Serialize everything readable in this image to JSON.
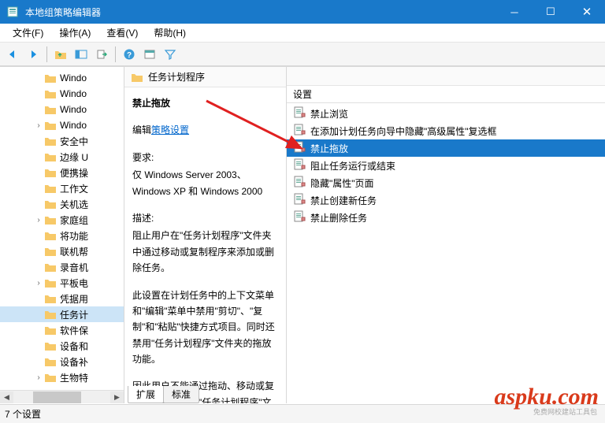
{
  "window": {
    "title": "本地组策略编辑器"
  },
  "menubar": {
    "file": "文件(F)",
    "action": "操作(A)",
    "view": "查看(V)",
    "help": "帮助(H)"
  },
  "tree": {
    "items": [
      {
        "label": "Windo",
        "expand": ""
      },
      {
        "label": "Windo",
        "expand": ""
      },
      {
        "label": "Windo",
        "expand": ""
      },
      {
        "label": "Windo",
        "expand": "›"
      },
      {
        "label": "安全中",
        "expand": ""
      },
      {
        "label": "边缘 U",
        "expand": ""
      },
      {
        "label": "便携操",
        "expand": ""
      },
      {
        "label": "工作文",
        "expand": ""
      },
      {
        "label": "关机选",
        "expand": ""
      },
      {
        "label": "家庭组",
        "expand": "›"
      },
      {
        "label": "将功能",
        "expand": ""
      },
      {
        "label": "联机帮",
        "expand": ""
      },
      {
        "label": "录音机",
        "expand": ""
      },
      {
        "label": "平板电",
        "expand": "›"
      },
      {
        "label": "凭据用",
        "expand": ""
      },
      {
        "label": "任务计",
        "expand": "",
        "selected": true
      },
      {
        "label": "软件保",
        "expand": ""
      },
      {
        "label": "设备和",
        "expand": ""
      },
      {
        "label": "设备补",
        "expand": ""
      },
      {
        "label": "生物特",
        "expand": "›"
      }
    ]
  },
  "mid": {
    "header": "任务计划程序",
    "title": "禁止拖放",
    "edit_link_prefix": "编辑",
    "edit_link": "策略设置",
    "req_label": "要求:",
    "req_text": "仅 Windows Server 2003、Windows XP 和 Windows 2000",
    "desc_label": "描述:",
    "desc1": "阻止用户在\"任务计划程序\"文件夹中通过移动或复制程序来添加或删除任务。",
    "desc2": "此设置在计划任务中的上下文菜单和\"编辑\"菜单中禁用\"剪切\"、\"复制\"和\"粘贴\"快捷方式项目。同时还禁用\"任务计划程序\"文件夹的拖放功能。",
    "desc3": "因此用户不能通过拖动、移动或复制文档或程序向\"任务计划程序\"文"
  },
  "right": {
    "column": "设置",
    "items": [
      {
        "label": "禁止浏览"
      },
      {
        "label": "在添加计划任务向导中隐藏\"高级属性\"复选框"
      },
      {
        "label": "禁止拖放",
        "selected": true
      },
      {
        "label": "阻止任务运行或结束"
      },
      {
        "label": "隐藏\"属性\"页面"
      },
      {
        "label": "禁止创建新任务"
      },
      {
        "label": "禁止删除任务"
      }
    ]
  },
  "tabs": {
    "extended": "扩展",
    "standard": "标准"
  },
  "statusbar": {
    "count": "7 个设置"
  },
  "watermark": {
    "text": "aspku.com",
    "sub": "免费网校建站工具包"
  }
}
